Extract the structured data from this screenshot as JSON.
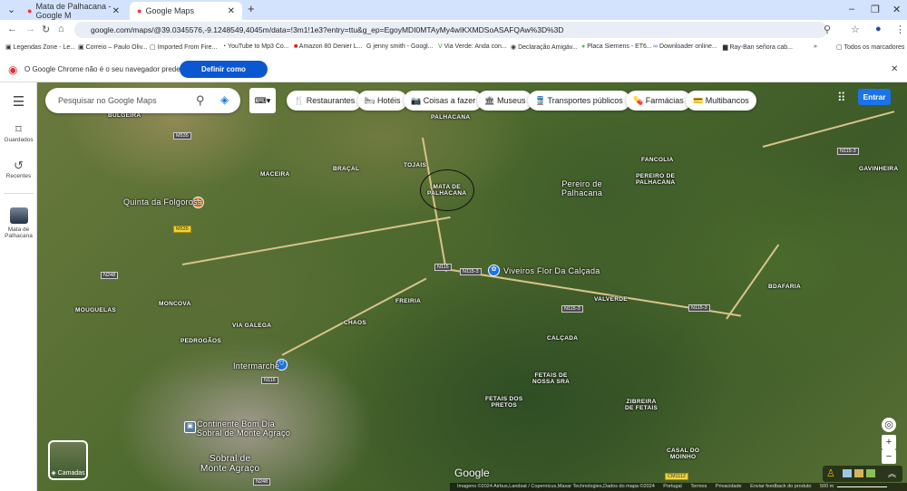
{
  "browser": {
    "tabs": [
      {
        "title": "Mata de Palhacana - Google M",
        "active": false
      },
      {
        "title": "Google Maps",
        "active": true
      }
    ],
    "url": "google.com/maps/@39.0345576,-9.1248549,4045m/data=!3m1!1e3?entry=ttu&g_ep=EgoyMDI0MTAyMy4wIKXMDSoASAFQAw%3D%3D",
    "bookmarks": [
      "Legendas Zone - Le...",
      "Correio – Paulo Oliv...",
      "Imported From Fire...",
      "YouTube to Mp3 Co...",
      "Amazon 80 Denier L...",
      "jenny smith - Googl...",
      "Via Verde: Anda con...",
      "Declaração Amigáv...",
      "Placa Siemens - ET6...",
      "Downloader online...",
      "Ray-Ban señora cab..."
    ],
    "all_bookmarks": "Todos os marcadores",
    "infobar_text": "O Google Chrome não é o seu navegador predefinido.",
    "infobar_button": "Definir como predefinição"
  },
  "rail": {
    "saved": "Guardados",
    "recent": "Recentes",
    "place": "Mata de Palhacana"
  },
  "search": {
    "placeholder": "Pesquisar no Google Maps"
  },
  "chips": [
    "Restaurantes",
    "Hotéis",
    "Coisas a fazer",
    "Museus",
    "Transportes públicos",
    "Farmácias",
    "Multibancos"
  ],
  "signin": "Entrar",
  "layers": "Camadas",
  "map_labels": {
    "bulgeira": "BULGEIRA",
    "maceira": "MACEIRA",
    "bracal": "BRAÇAL",
    "tojais": "TOJAIS",
    "palhacana": "PALHACANA",
    "mata": "MATA DE\nPALHACANA",
    "pereiro": "Pereiro de\nPalhacana",
    "fancolia": "FANCOLIA",
    "pereiro_caps": "PEREIRO DE\nPALHACANA",
    "gavinheira": "GAVINHEIRA",
    "quinta": "Quinta da Folgorosa",
    "viveiros": "Viveiros Flor Da Calçada",
    "mougelas": "MOUGUELAS",
    "moncova": "MONCOVA",
    "freiria": "FREIRIA",
    "chaos": "CHAOS",
    "via_galega": "VIA GALEGA",
    "pedrogaos": "PEDROGÃOS",
    "intermarche": "Intermarché",
    "valverde": "VALVERDE",
    "bdafaria": "BDAFARIA",
    "calcada": "CALÇADA",
    "fetais_senhora": "FETAIS DE\nNOSSA SRA",
    "fetais_pretos": "FETAIS DOS\nPRETOS",
    "zibreira": "ZIBREIRA\nDE FETAIS",
    "casal": "CASAL DO\nMOINHO",
    "continente": "Continente Bom Dia\nSobral de Monte Agraço",
    "sobral": "Sobral de\nMonte Agraço"
  },
  "roads": {
    "m535": "M535",
    "m535b": "M535",
    "n248": "N248",
    "n115": "N115",
    "n1153": "N115-3",
    "n1153b": "N115-3",
    "n1153c": "N115-3",
    "n1153d": "N115-3",
    "n115b": "N115",
    "n248b": "N248",
    "cm1112": "CM1112"
  },
  "footer": {
    "imagery": "Imagens ©2024 Airbus,Landsat / Copernicus,Maxar Technologies,Dados do mapa ©2024",
    "country": "Portugal",
    "terms": "Termos",
    "privacy": "Privacidade",
    "feedback": "Enviar feedback do produto",
    "scale": "500 m"
  },
  "logo": "Google"
}
